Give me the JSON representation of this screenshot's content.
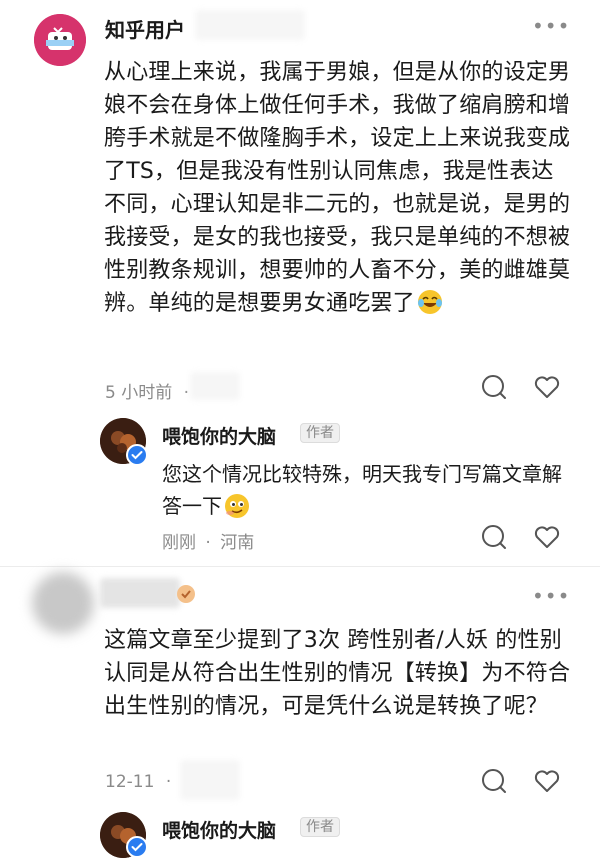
{
  "comments": [
    {
      "username": "知乎用户",
      "content": "从心理上来说，我属于男娘，但是从你的设定男娘不会在身体上做任何手术，我做了缩肩膀和增胯手术就是不做隆胸手术，设定上上来说我变成了TS，但是我没有性别认同焦虑，我是性表达不同，心理认知是非二元的，也就是说，是男的我接受，是女的我也接受，我只是单纯的不想被性别教条规训，想要帅的人畜不分，美的雌雄莫辨。单纯的是想要男女通吃罢了",
      "time": "5 小时前",
      "separator": "·",
      "more": "•••",
      "reply": {
        "username": "喂饱你的大脑",
        "tag": "作者",
        "content": "您这个情况比较特殊，明天我专门写篇文章解答一下",
        "time": "刚刚",
        "separator": "·",
        "location": "河南"
      }
    },
    {
      "username": "",
      "content": "这篇文章至少提到了3次 跨性别者/人妖 的性别认同是从符合出生性别的情况【转换】为不符合出生性别的情况，可是凭什么说是转换了呢？",
      "time": "12-11",
      "separator": "·",
      "more": "•••",
      "reply": {
        "username": "喂饱你的大脑",
        "tag": "作者"
      }
    }
  ],
  "colors": {
    "text": "#1a1a1a",
    "meta": "#8a8a8a",
    "verified": "#2a7cf0",
    "avatar1": "#d6336c"
  },
  "icons": [
    "more-icon",
    "comment-icon",
    "like-icon",
    "verified-icon",
    "laugh-cry-emoji",
    "smirk-emoji"
  ]
}
